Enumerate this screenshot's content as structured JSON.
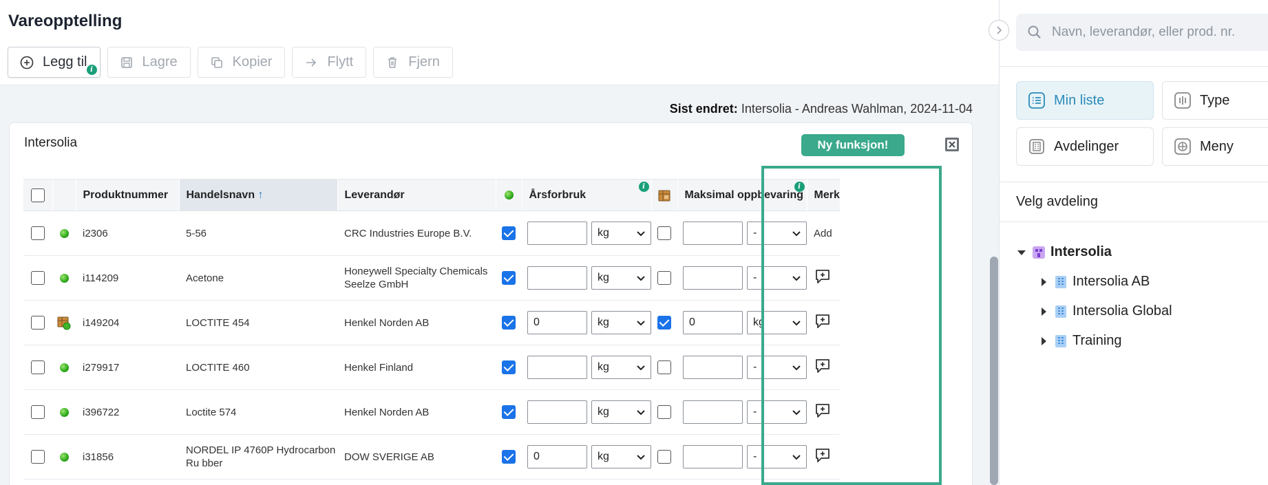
{
  "page": {
    "title": "Vareopptelling"
  },
  "toolbar": {
    "buttons": [
      {
        "label": "Legg til",
        "icon": "plus-circle-icon",
        "enabled": true
      },
      {
        "label": "Lagre",
        "icon": "save-icon",
        "enabled": false
      },
      {
        "label": "Kopier",
        "icon": "copy-icon",
        "enabled": false
      },
      {
        "label": "Flytt",
        "icon": "arrow-right-icon",
        "enabled": false
      },
      {
        "label": "Fjern",
        "icon": "trash-icon",
        "enabled": false
      }
    ],
    "info_badge": "i"
  },
  "last_changed": {
    "label": "Sist endret:",
    "value": "Intersolia - Andreas Wahlman, 2024-11-04"
  },
  "card": {
    "title": "Intersolia",
    "new_feature_label": "Ny funksjon!",
    "excel_icon": "excel-export-icon"
  },
  "table": {
    "columns": {
      "product_number": "Produktnummer",
      "trade_name": "Handelsnavn",
      "supplier": "Leverandør",
      "annual_use": "Årsforbruk",
      "max_storage": "Maksimal oppbevaring",
      "remarks": "Merk"
    },
    "sort_indicator": "↑",
    "add_text": "Add",
    "rows": [
      {
        "status": "green",
        "product_number": "i2306",
        "trade_name": "5-56",
        "supplier": "CRC Industries Europe B.V.",
        "active": true,
        "annual_value": "",
        "annual_unit": "kg",
        "storage_checked": false,
        "storage_value": "",
        "storage_unit": "-",
        "remark": "add-text"
      },
      {
        "status": "green",
        "product_number": "i114209",
        "trade_name": "Acetone",
        "supplier": "Honeywell Specialty Chemicals Seelze GmbH",
        "active": true,
        "annual_value": "",
        "annual_unit": "kg",
        "storage_checked": false,
        "storage_value": "",
        "storage_unit": "-",
        "remark": "comment-add-icon"
      },
      {
        "status": "package",
        "product_number": "i149204",
        "trade_name": "LOCTITE 454",
        "supplier": "Henkel Norden AB",
        "active": true,
        "annual_value": "0",
        "annual_unit": "kg",
        "storage_checked": true,
        "storage_value": "0",
        "storage_unit": "kg",
        "remark": "comment-add-icon"
      },
      {
        "status": "green",
        "product_number": "i279917",
        "trade_name": "LOCTITE 460",
        "supplier": "Henkel Finland",
        "active": true,
        "annual_value": "",
        "annual_unit": "kg",
        "storage_checked": false,
        "storage_value": "",
        "storage_unit": "-",
        "remark": "comment-add-icon"
      },
      {
        "status": "green",
        "product_number": "i396722",
        "trade_name": "Loctite 574",
        "supplier": "Henkel Norden AB",
        "active": true,
        "annual_value": "",
        "annual_unit": "kg",
        "storage_checked": false,
        "storage_value": "",
        "storage_unit": "-",
        "remark": "comment-add-icon"
      },
      {
        "status": "green",
        "product_number": "i31856",
        "trade_name": "NORDEL IP 4760P Hydrocarbon Ru bber",
        "supplier": "DOW SVERIGE AB",
        "active": true,
        "annual_value": "0",
        "annual_unit": "kg",
        "storage_checked": false,
        "storage_value": "",
        "storage_unit": "-",
        "remark": "comment-add-icon"
      }
    ]
  },
  "sidebar": {
    "search": {
      "placeholder": "Navn, leverandør, eller prod. nr."
    },
    "modes": [
      {
        "label": "Min liste",
        "icon": "list-icon",
        "active": true
      },
      {
        "label": "Type",
        "icon": "type-icon",
        "active": false
      },
      {
        "label": "Avdelinger",
        "icon": "departments-icon",
        "active": false
      },
      {
        "label": "Meny",
        "icon": "menu-icon",
        "active": false
      }
    ],
    "dept_heading": "Velg avdeling",
    "tree": [
      {
        "label": "Intersolia",
        "expanded": true,
        "icon": "organization-icon"
      },
      {
        "label": "Intersolia AB",
        "expanded": false,
        "icon": "building-icon"
      },
      {
        "label": "Intersolia Global",
        "expanded": false,
        "icon": "building-icon"
      },
      {
        "label": "Training",
        "expanded": false,
        "icon": "building-icon"
      }
    ]
  },
  "colors": {
    "accent": "#3aa98c",
    "checkbox": "#1a73e8",
    "active_mode": "#2a8ab7"
  }
}
